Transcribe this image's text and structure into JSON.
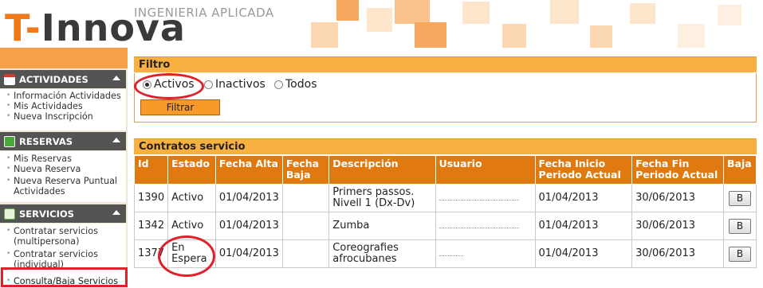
{
  "header": {
    "tagline": "INGENIERIA APLICADA",
    "logo_t": "T-",
    "logo_rest": "Innova"
  },
  "sidebar": {
    "sections": [
      {
        "title": "ACTIVIDADES",
        "icon": "calendar-icon",
        "items": [
          "Información Actividades",
          "Mis Actividades",
          "Nueva Inscripción"
        ]
      },
      {
        "title": "RESERVAS",
        "icon": "court-icon",
        "items": [
          "Mis Reservas",
          "Nueva Reserva",
          "Nueva Reserva Puntual Actividades"
        ]
      },
      {
        "title": "SERVICIOS",
        "icon": "document-icon",
        "items": [
          "Contratar servicios (multipersona)",
          "Contratar servicios (individual)",
          "Consulta/Baja Servicios"
        ]
      }
    ]
  },
  "filter": {
    "title": "Filtro",
    "options": [
      "Activos",
      "Inactivos",
      "Todos"
    ],
    "selected": "Activos",
    "button_label": "Filtrar"
  },
  "contracts": {
    "title": "Contratos servicio",
    "columns": [
      "Id",
      "Estado",
      "Fecha Alta",
      "Fecha Baja",
      "Descripción",
      "Usuario",
      "Fecha Inicio Periodo Actual",
      "Fecha Fin Periodo Actual",
      "Baja"
    ],
    "rows": [
      {
        "id": "1390",
        "estado": "Activo",
        "alta": "01/04/2013",
        "baja": "",
        "descripcion": "Primers passos. Nivell 1 (Dx-Dv)",
        "usuario": "",
        "inicio": "01/04/2013",
        "fin": "30/06/2013",
        "btn": "B"
      },
      {
        "id": "1342",
        "estado": "Activo",
        "alta": "01/04/2013",
        "baja": "",
        "descripcion": "Zumba",
        "usuario": "",
        "inicio": "01/04/2013",
        "fin": "30/06/2013",
        "btn": "B"
      },
      {
        "id": "1377",
        "estado": "En Espera",
        "alta": "01/04/2013",
        "baja": "",
        "descripcion": "Coreografies afrocubanes",
        "usuario": "",
        "inicio": "01/04/2013",
        "fin": "30/06/2013",
        "btn": "B"
      }
    ]
  },
  "colors": {
    "accent": "#f07a1a",
    "header_orange": "#e07a10",
    "panel_title": "#f8b040",
    "annotation_red": "#e0202a"
  }
}
